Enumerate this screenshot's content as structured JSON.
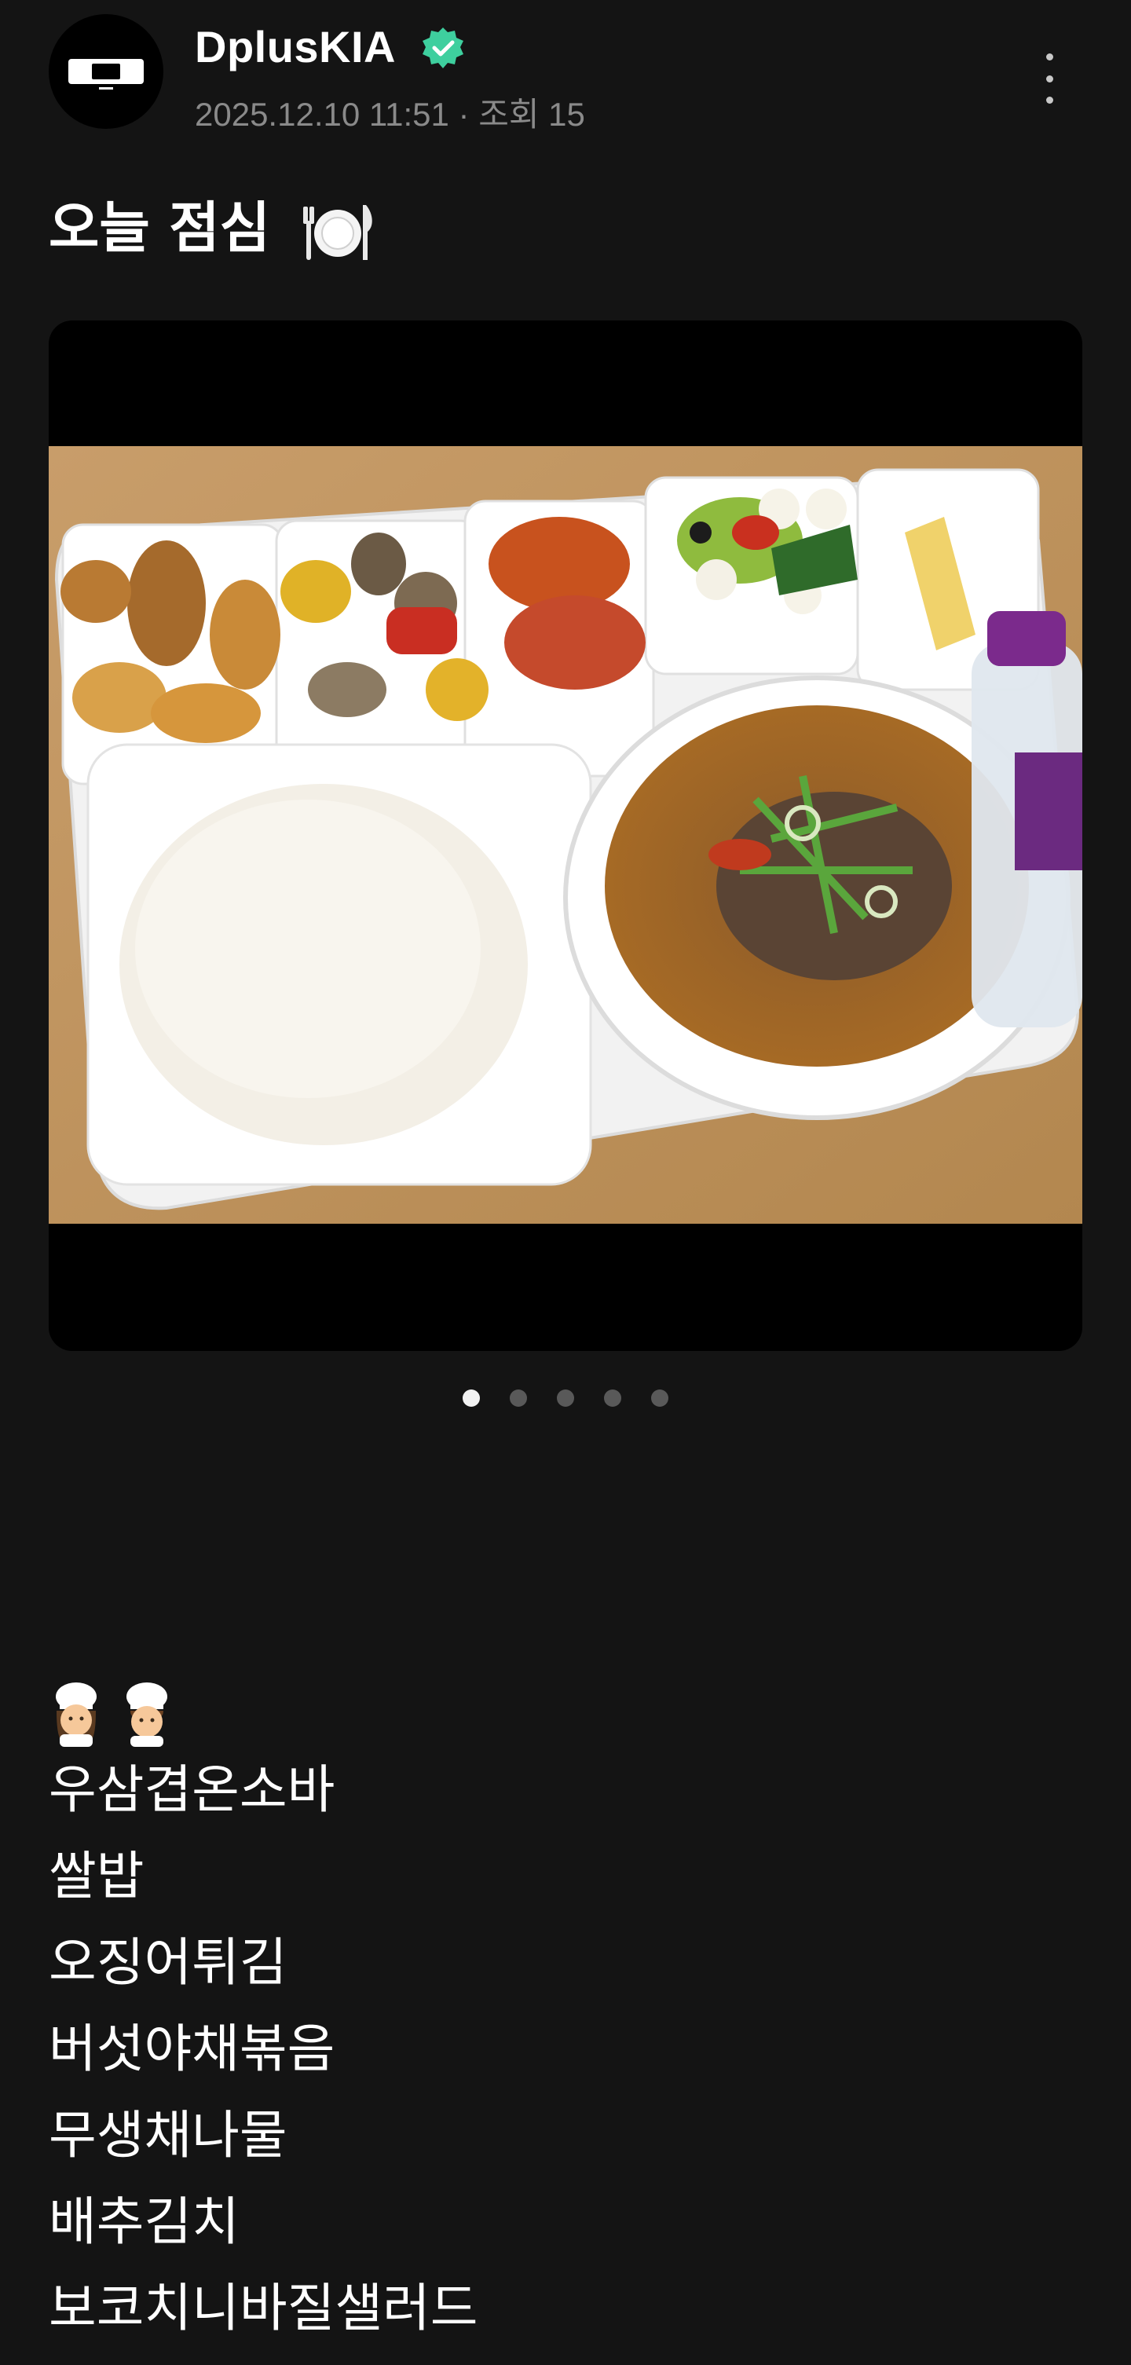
{
  "post": {
    "author": "DplusKIA",
    "verified": true,
    "date": "2025.12.10 11:51",
    "views_label": "조회 15",
    "title": "오늘 점심",
    "title_emoji": "plate-with-cutlery-icon"
  },
  "carousel": {
    "count": 5,
    "active_index": 0
  },
  "content": {
    "emojis": [
      "woman-cook-icon",
      "man-cook-icon"
    ],
    "menu": [
      "우삼겹온소바",
      "쌀밥",
      "오징어튀김",
      "버섯야채볶음",
      "무생채나물",
      "배추김치",
      "보코치니바질샐러드"
    ]
  },
  "colors": {
    "background": "#141414",
    "verified_badge": "#3ecf9e",
    "meta_text": "#8a8a8a",
    "dot_active": "#f2f2f2",
    "dot_inactive": "#595959"
  }
}
